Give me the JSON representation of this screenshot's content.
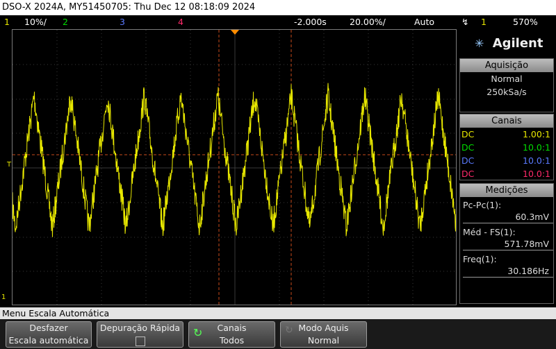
{
  "titlebar": {
    "text": "DSO-X 2024A, MY51450705: Thu Dec 12 08:18:09 2024"
  },
  "status": {
    "ch1_num": "1",
    "ch1_scale": "10%/",
    "ch2_num": "2",
    "ch3_num": "3",
    "ch4_num": "4",
    "delay": "-2.000s",
    "timebase": "20.00%/",
    "mode": "Auto",
    "trig_num": "1",
    "trig_level": "570%"
  },
  "colors": {
    "ch1": "#e8e800",
    "ch2": "#00dd00",
    "ch3": "#5a7aff",
    "ch4": "#ff2a6a"
  },
  "logo": {
    "brand": "Agilent"
  },
  "acq": {
    "head": "Aquisição",
    "mode": "Normal",
    "rate": "250kSa/s"
  },
  "channels": {
    "head": "Canais",
    "rows": [
      {
        "coupling": "DC",
        "probe": "1.00:1"
      },
      {
        "coupling": "DC",
        "probe": "10.0:1"
      },
      {
        "coupling": "DC",
        "probe": "10.0:1"
      },
      {
        "coupling": "DC",
        "probe": "10.0:1"
      }
    ]
  },
  "meas": {
    "head": "Medições",
    "items": [
      {
        "label": "Pc-Pc(1):",
        "value": "60.3mV"
      },
      {
        "label": "Méd - FS(1):",
        "value": "571.78mV"
      },
      {
        "label": "Freq(1):",
        "value": "30.186Hz"
      }
    ]
  },
  "menu": {
    "label": "Menu Escala Automática"
  },
  "softkeys": [
    {
      "line1": "Desfazer",
      "line2": "Escala automática"
    },
    {
      "line1": "Depuração Rápida",
      "line2": ""
    },
    {
      "line1": "Canais",
      "line2": "Todos"
    },
    {
      "line1": "Modo Aquis",
      "line2": "Normal"
    }
  ],
  "markers": {
    "trig": "T",
    "gnd": "1"
  }
}
